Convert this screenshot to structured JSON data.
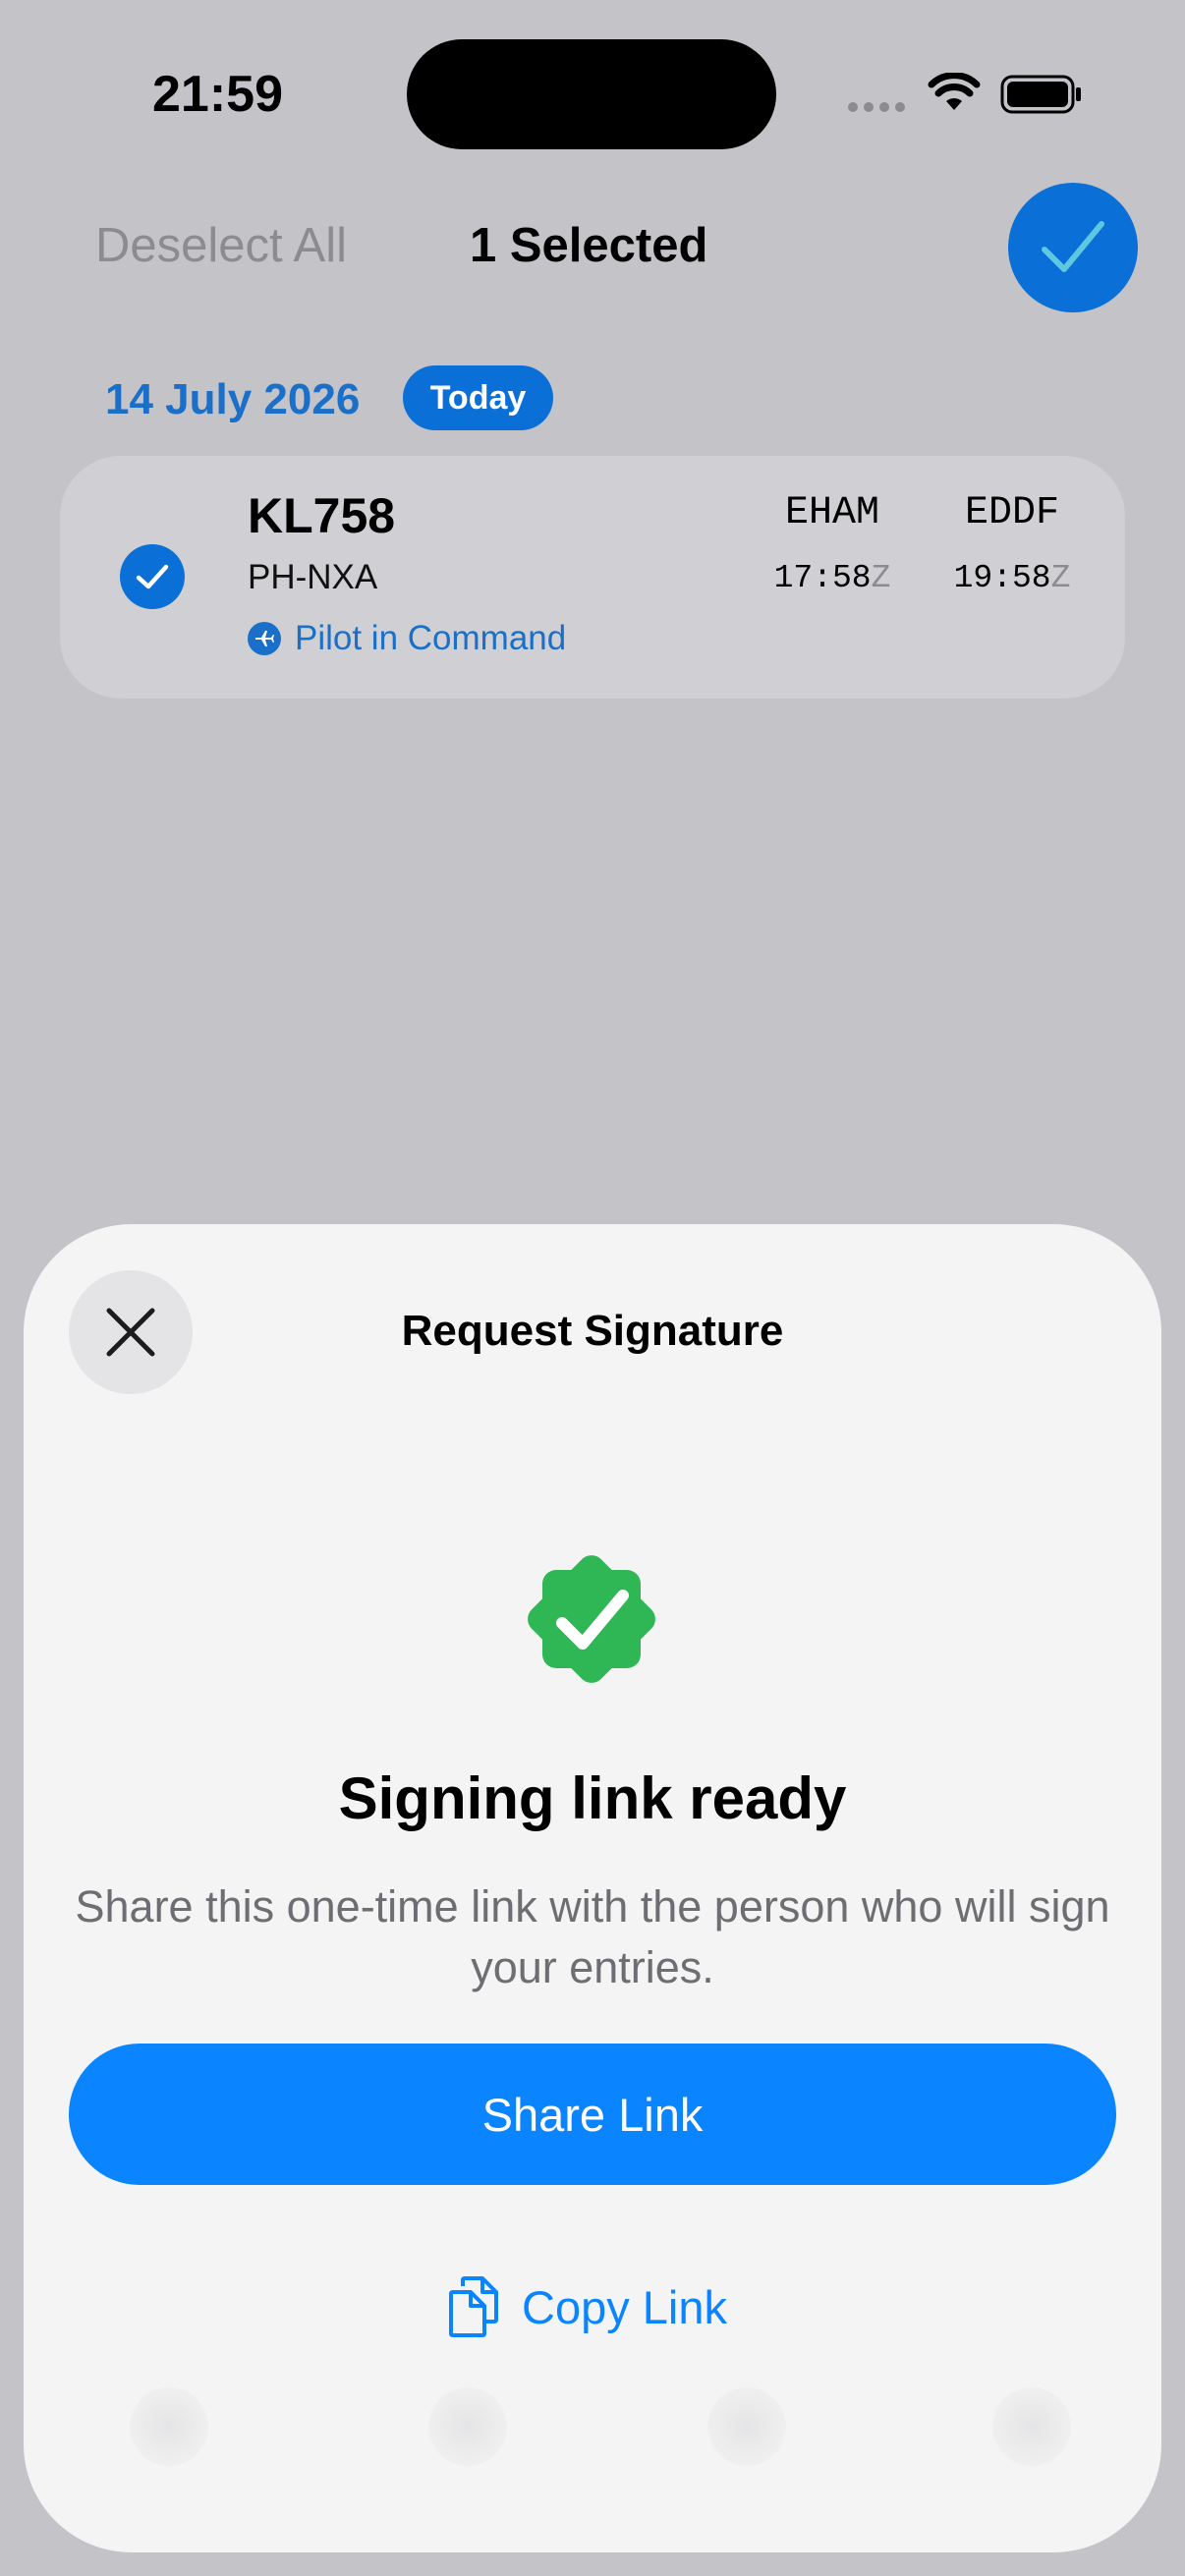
{
  "status_bar": {
    "time": "21:59"
  },
  "top_bar": {
    "deselect_label": "Deselect All",
    "selected_label": "1 Selected"
  },
  "date_header": {
    "date": "14 July 2026",
    "badge": "Today"
  },
  "flight": {
    "number": "KL758",
    "registration": "PH-NXA",
    "role": "Pilot in Command",
    "departure": {
      "code": "EHAM",
      "time": "17:58",
      "zone": "Z"
    },
    "arrival": {
      "code": "EDDF",
      "time": "19:58",
      "zone": "Z"
    }
  },
  "sheet": {
    "title": "Request Signature",
    "headline": "Signing link ready",
    "subtitle": "Share this one-time link with the person who will sign your entries.",
    "share_label": "Share Link",
    "copy_label": "Copy Link"
  },
  "colors": {
    "accent": "#0a84ff",
    "success": "#2fb755",
    "selected": "#0a6fd7"
  },
  "icons": {
    "done": "checkmark-icon",
    "close": "close-icon",
    "success": "checkmark-seal-icon",
    "copy": "copy-icon",
    "role": "airplane-icon"
  }
}
